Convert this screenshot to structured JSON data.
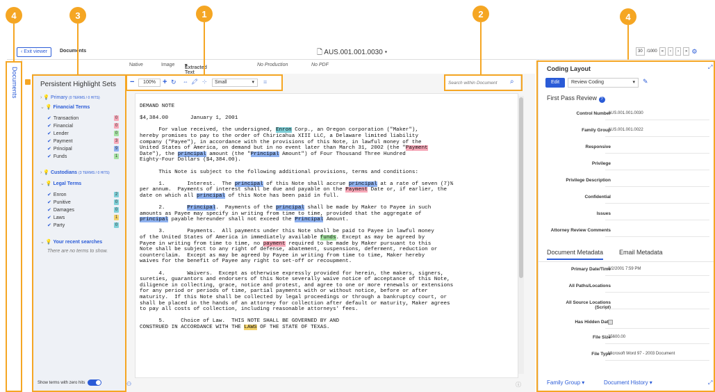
{
  "callouts": [
    "1",
    "2",
    "3",
    "4",
    "4"
  ],
  "topbar": {
    "exit_label": "Exit viewer",
    "documents_label": "Documents",
    "doc_id": "AUS.001.001.0030",
    "page_current": "30",
    "page_total": "/1000"
  },
  "tabs": [
    "Native",
    "Image",
    "Extracted Text",
    "No Production",
    "No PDF"
  ],
  "sidebar": {
    "label": "Documents"
  },
  "highlights": {
    "title": "Persistent Highlight Sets",
    "primary": {
      "name": "Primary",
      "meta": "(0 TERMS / 0 HITS)"
    },
    "financial": {
      "name": "Financial Terms",
      "terms": [
        {
          "label": "Transaction",
          "count": "0",
          "color": "#f7a8b8"
        },
        {
          "label": "Financial",
          "count": "0",
          "color": "#f7a8b8"
        },
        {
          "label": "Lender",
          "count": "0",
          "color": "#a6e3a3"
        },
        {
          "label": "Payment",
          "count": "3",
          "color": "#f7a8b8"
        },
        {
          "label": "Principal",
          "count": "9",
          "color": "#8fb2f0"
        },
        {
          "label": "Funds",
          "count": "1",
          "color": "#a6e3a3"
        }
      ]
    },
    "custodians": {
      "name": "Custodians",
      "meta": "(3 TERMS / 0 HITS)"
    },
    "legal": {
      "name": "Legal Terms",
      "terms": [
        {
          "label": "Enron",
          "count": "2",
          "color": "#7fd0d8"
        },
        {
          "label": "Punitive",
          "count": "0",
          "color": "#7fd0d8"
        },
        {
          "label": "Damages",
          "count": "0",
          "color": "#7fd0d8"
        },
        {
          "label": "Laws",
          "count": "1",
          "color": "#f3d26b"
        },
        {
          "label": "Party",
          "count": "0",
          "color": "#7fd0d8"
        }
      ]
    },
    "recent": {
      "name": "Your recent searches",
      "empty": "There are no terms to show."
    },
    "toggle_label": "Show terms with zero hits"
  },
  "toolbar": {
    "zoom": "100%",
    "font_size": "Small"
  },
  "search": {
    "placeholder": "Search within Document"
  },
  "document": {
    "title": "DEMAND NOTE",
    "amount_line": "$4,384.00       January 1, 2001"
  },
  "coding": {
    "title": "Coding Layout",
    "edit_label": "Edit",
    "layout_select": "Review Coding",
    "section": "First Pass Review",
    "fields": [
      {
        "label": "Control Number",
        "value": "AUS.001.001.0030"
      },
      {
        "label": "Family Group",
        "value": "AUS.001.001.0022"
      },
      {
        "label": "Responsive",
        "value": ""
      },
      {
        "label": "Privilege",
        "value": ""
      },
      {
        "label": "Privilege Description",
        "value": ""
      },
      {
        "label": "Confidential",
        "value": ""
      },
      {
        "label": "Issues",
        "value": ""
      },
      {
        "label": "Attorney Review Comments",
        "value": ""
      }
    ]
  },
  "metadata": {
    "tab1": "Document Metadata",
    "tab2": "Email Metadata",
    "fields": [
      {
        "label": "Primary Date/Time",
        "value": "8/2/2001 7:59 PM"
      },
      {
        "label": "All Paths/Locations",
        "value": ""
      },
      {
        "label": "All Source Locations (Script)",
        "value": ""
      },
      {
        "label": "Has Hidden Data",
        "value": ""
      },
      {
        "label": "File Size",
        "value": "25600.00"
      },
      {
        "label": "File Type",
        "value": "Microsoft Word 97 - 2003 Document"
      }
    ]
  },
  "footer": {
    "family_group": "Family Group",
    "doc_history": "Document History"
  }
}
